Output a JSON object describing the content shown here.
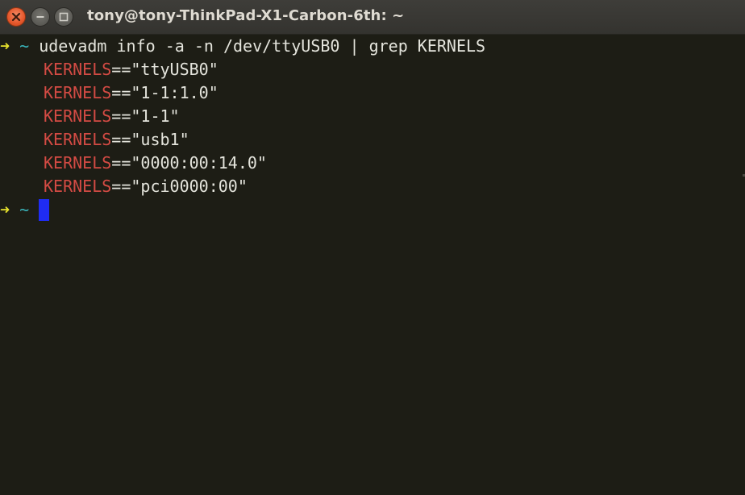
{
  "window": {
    "title": "tony@tony-ThinkPad-X1-Carbon-6th: ~",
    "buttons": {
      "close_icon": "close-icon",
      "minimize_icon": "minimize-icon",
      "maximize_icon": "maximize-icon"
    }
  },
  "terminal": {
    "prompt_arrow": "➜",
    "prompt_dir": "~",
    "command": "udevadm info -a -n /dev/ttyUSB0 | grep KERNELS",
    "output": [
      {
        "key": "KERNELS",
        "op": "==",
        "value": "\"ttyUSB0\""
      },
      {
        "key": "KERNELS",
        "op": "==",
        "value": "\"1-1:1.0\""
      },
      {
        "key": "KERNELS",
        "op": "==",
        "value": "\"1-1\""
      },
      {
        "key": "KERNELS",
        "op": "==",
        "value": "\"usb1\""
      },
      {
        "key": "KERNELS",
        "op": "==",
        "value": "\"0000:00:14.0\""
      },
      {
        "key": "KERNELS",
        "op": "==",
        "value": "\"pci0000:00\""
      }
    ],
    "second_prompt_arrow": "➜",
    "second_prompt_dir": "~"
  },
  "colors": {
    "background": "#1d1d15",
    "prompt_arrow": "#e7e22d",
    "prompt_dir": "#39b2b8",
    "keyword": "#d44b44",
    "text": "#e4e4dc",
    "cursor": "#1f2cf2"
  }
}
